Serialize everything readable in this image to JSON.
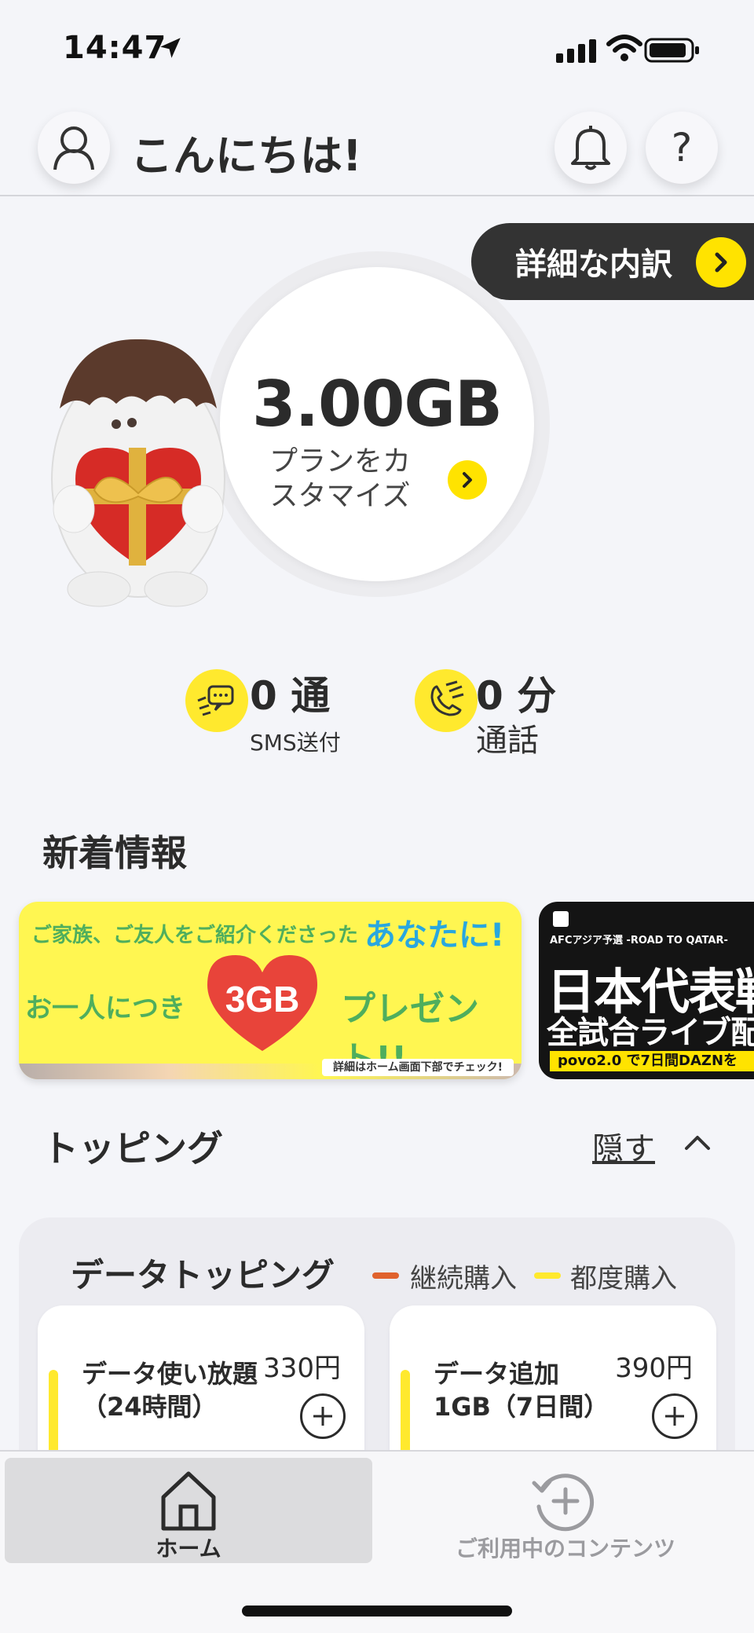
{
  "status_bar": {
    "time": "14:47"
  },
  "header": {
    "greeting": "こんにちは!",
    "help_label": "?"
  },
  "breakdown": {
    "label": "詳細な内訳"
  },
  "data": {
    "amount": "3.00GB",
    "customize_label": "プランをカスタマイズ"
  },
  "usage": {
    "sms": {
      "value": "0 通",
      "label": "SMS送付"
    },
    "call": {
      "value": "0 分",
      "label": "通話"
    }
  },
  "news": {
    "title": "新着情報",
    "banner1": {
      "top": "ご家族、ご友人をご紹介くださった",
      "top_highlight": "あなたに!",
      "left": "お一人につき",
      "heart": "3GB",
      "right": "プレゼント!!",
      "foot": "詳細はホーム画面下部でチェック!"
    },
    "banner2": {
      "top": "AFCアジア予選 -ROAD TO QATAR-",
      "main": "日本代表戦",
      "sub": "全試合ライブ配信",
      "foot": "povo2.0 で7日間DAZNを"
    }
  },
  "topping": {
    "title": "トッピング",
    "hide_label": "隠す",
    "data_title": "データトッピング",
    "legend": [
      {
        "label": "継続購入",
        "color": "#e0622d"
      },
      {
        "label": "都度購入",
        "color": "#ffe92e"
      }
    ],
    "cards": [
      {
        "name": "データ使い放題（24時間）",
        "price": "330円"
      },
      {
        "name": "データ追加1GB（7日間）",
        "price": "390円"
      }
    ]
  },
  "bottom_nav": {
    "home_label": "ホーム",
    "contents_label": "ご利用中のコンテンツ"
  },
  "colors": {
    "accent": "#ffe300",
    "dark_pill": "#333333",
    "background": "#f4f5f9"
  }
}
